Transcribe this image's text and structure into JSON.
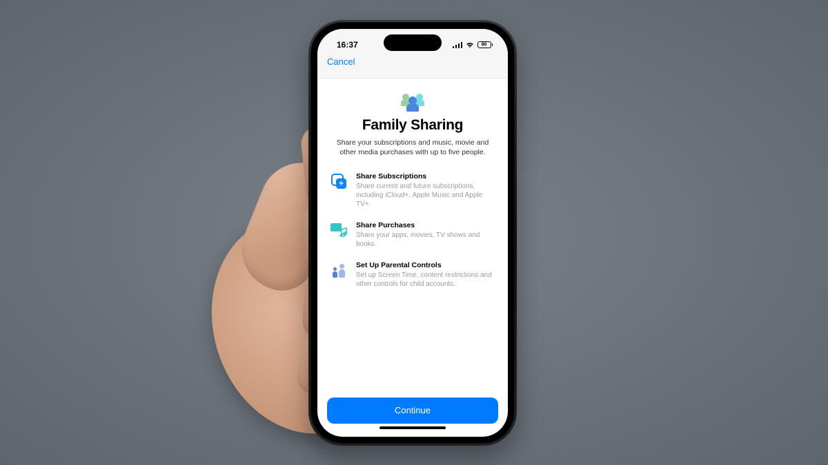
{
  "status": {
    "time": "16:37",
    "battery_pct": "80"
  },
  "nav": {
    "cancel_label": "Cancel"
  },
  "hero": {
    "title": "Family Sharing",
    "subtitle": "Share your subscriptions and music, movie and other media purchases with up to five people."
  },
  "features": [
    {
      "title": "Share Subscriptions",
      "body": "Share current and future subscriptions, including iCloud+, Apple Music and Apple TV+."
    },
    {
      "title": "Share Purchases",
      "body": "Share your apps, movies, TV shows and books."
    },
    {
      "title": "Set Up Parental Controls",
      "body": "Set up Screen Time, content restrictions and other controls for child accounts."
    }
  ],
  "footer": {
    "continue_label": "Continue"
  }
}
